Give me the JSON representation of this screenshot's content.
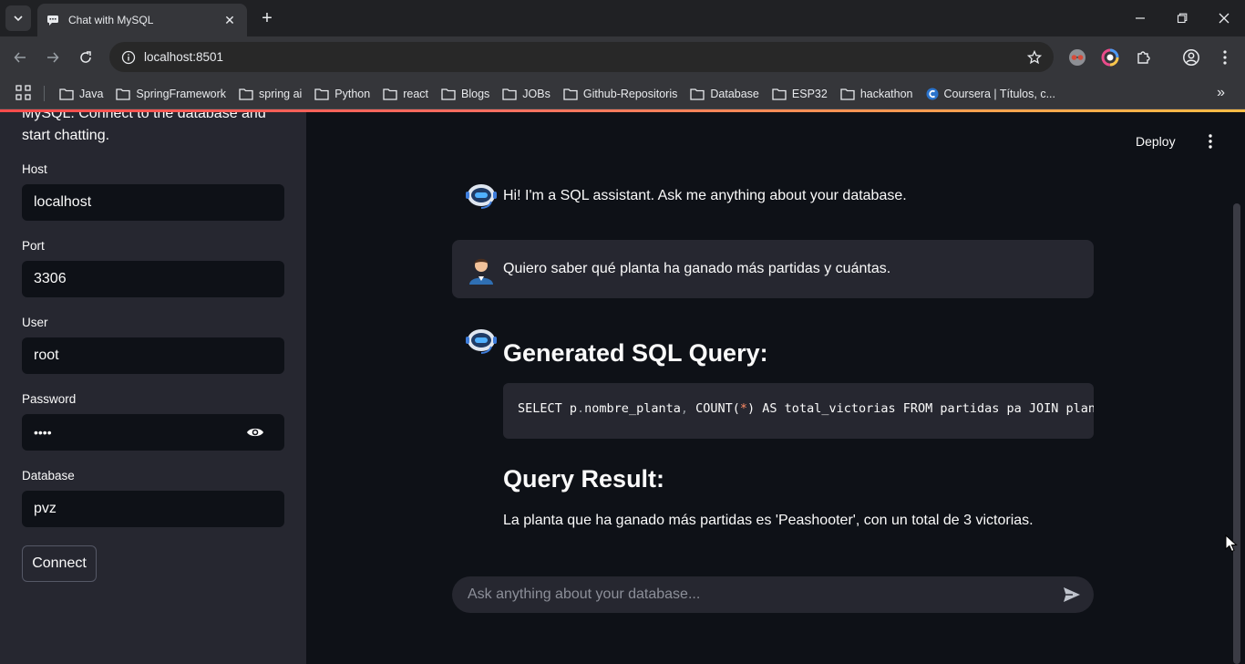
{
  "browser": {
    "tab_title": "Chat with MySQL",
    "url": "localhost:8501",
    "bookmarks": [
      "Java",
      "SpringFramework",
      "spring ai",
      "Python",
      "react",
      "Blogs",
      "JOBs",
      "Github-Repositoris",
      "Database",
      "ESP32",
      "hackathon",
      "Coursera | Títulos, c..."
    ]
  },
  "sidebar": {
    "intro": "MySQL. Connect to the database and start chatting.",
    "host_label": "Host",
    "host_value": "localhost",
    "port_label": "Port",
    "port_value": "3306",
    "user_label": "User",
    "user_value": "root",
    "password_label": "Password",
    "password_value": "••••",
    "database_label": "Database",
    "database_value": "pvz",
    "connect_label": "Connect"
  },
  "header": {
    "deploy_label": "Deploy"
  },
  "chat": {
    "assistant_greeting": "Hi! I'm a SQL assistant. Ask me anything about your database.",
    "user_question": "Quiero saber qué planta ha ganado más partidas y cuántas.",
    "generated_heading": "Generated SQL Query:",
    "sql_parts": {
      "a": "SELECT p",
      "b": ".",
      "c": "nombre_planta",
      "d": ",",
      "e": " COUNT(",
      "f": "*",
      "g": ")",
      "h": " AS total_victorias FROM partidas pa JOIN plantas p ON pa.planta_ganadora_id = p.id GROUP BY p.nombre_planta ORDER BY total_victorias DESC LIMIT 1;"
    },
    "result_heading": "Query Result:",
    "result_text": "La planta que ha ganado más partidas es 'Peashooter', con un total de 3 victorias.",
    "input_placeholder": "Ask anything about your database..."
  }
}
